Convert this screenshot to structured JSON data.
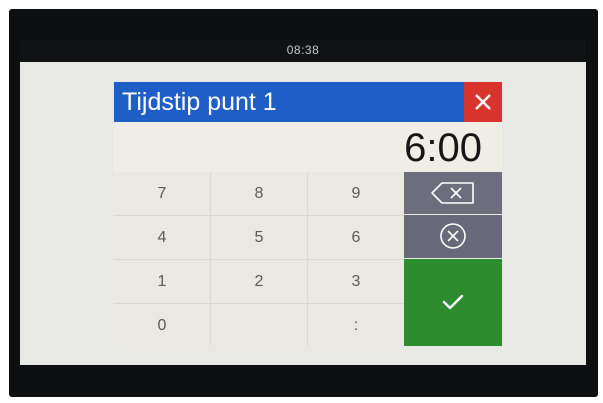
{
  "status_bar": {
    "time": "08:38"
  },
  "dialog": {
    "title": "Tijdstip punt 1",
    "value": "6:00",
    "close_icon": "close-icon"
  },
  "keypad": {
    "keys": [
      "7",
      "8",
      "9",
      "4",
      "5",
      "6",
      "1",
      "2",
      "3",
      "0",
      "",
      ":"
    ]
  },
  "actions": {
    "backspace_icon": "backspace-icon",
    "clear_icon": "clear-circle-icon",
    "confirm_icon": "checkmark-icon"
  },
  "colors": {
    "title_bar": "#1f5ec6",
    "close": "#d9342c",
    "side_buttons": "#6c6e7e",
    "confirm": "#2c8c2e"
  }
}
